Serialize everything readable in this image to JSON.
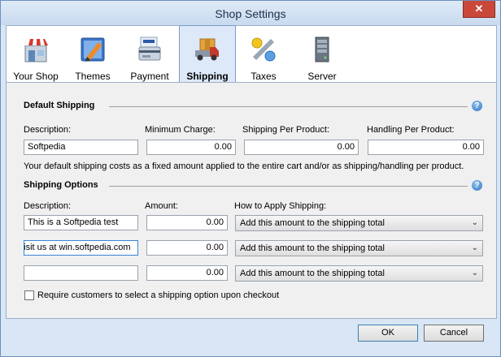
{
  "window": {
    "title": "Shop Settings",
    "close_label": "✕"
  },
  "tabs": [
    {
      "label": "Your Shop",
      "icon": "storefront-icon"
    },
    {
      "label": "Themes",
      "icon": "themes-icon"
    },
    {
      "label": "Payment",
      "icon": "payment-icon"
    },
    {
      "label": "Shipping",
      "icon": "truck-icon",
      "active": true
    },
    {
      "label": "Taxes",
      "icon": "percent-icon"
    },
    {
      "label": "Server",
      "icon": "server-icon"
    }
  ],
  "default_shipping": {
    "heading": "Default Shipping",
    "description_label": "Description:",
    "min_charge_label": "Minimum Charge:",
    "per_product_label": "Shipping Per Product:",
    "handling_label": "Handling Per Product:",
    "description_value": "Softpedia",
    "min_charge_value": "0.00",
    "per_product_value": "0.00",
    "handling_value": "0.00",
    "note": "Your default shipping costs as a fixed amount applied to the entire cart and/or as shipping/handling per product."
  },
  "shipping_options": {
    "heading": "Shipping Options",
    "description_label": "Description:",
    "amount_label": "Amount:",
    "how_label": "How to Apply Shipping:",
    "rows": [
      {
        "description": "This is a Softpedia test",
        "amount": "0.00",
        "how": "Add this amount to the shipping total"
      },
      {
        "description": "Visit us at win.softpedia.com",
        "amount": "0.00",
        "how": "Add this amount to the shipping total"
      },
      {
        "description": "",
        "amount": "0.00",
        "how": "Add this amount to the shipping total"
      }
    ],
    "require_label": "Require customers to select a shipping option upon checkout"
  },
  "buttons": {
    "ok": "OK",
    "cancel": "Cancel"
  },
  "help_glyph": "?",
  "colors": {
    "accent": "#3a83d6",
    "close": "#c9483a",
    "active_tab": "#dde9f8"
  }
}
